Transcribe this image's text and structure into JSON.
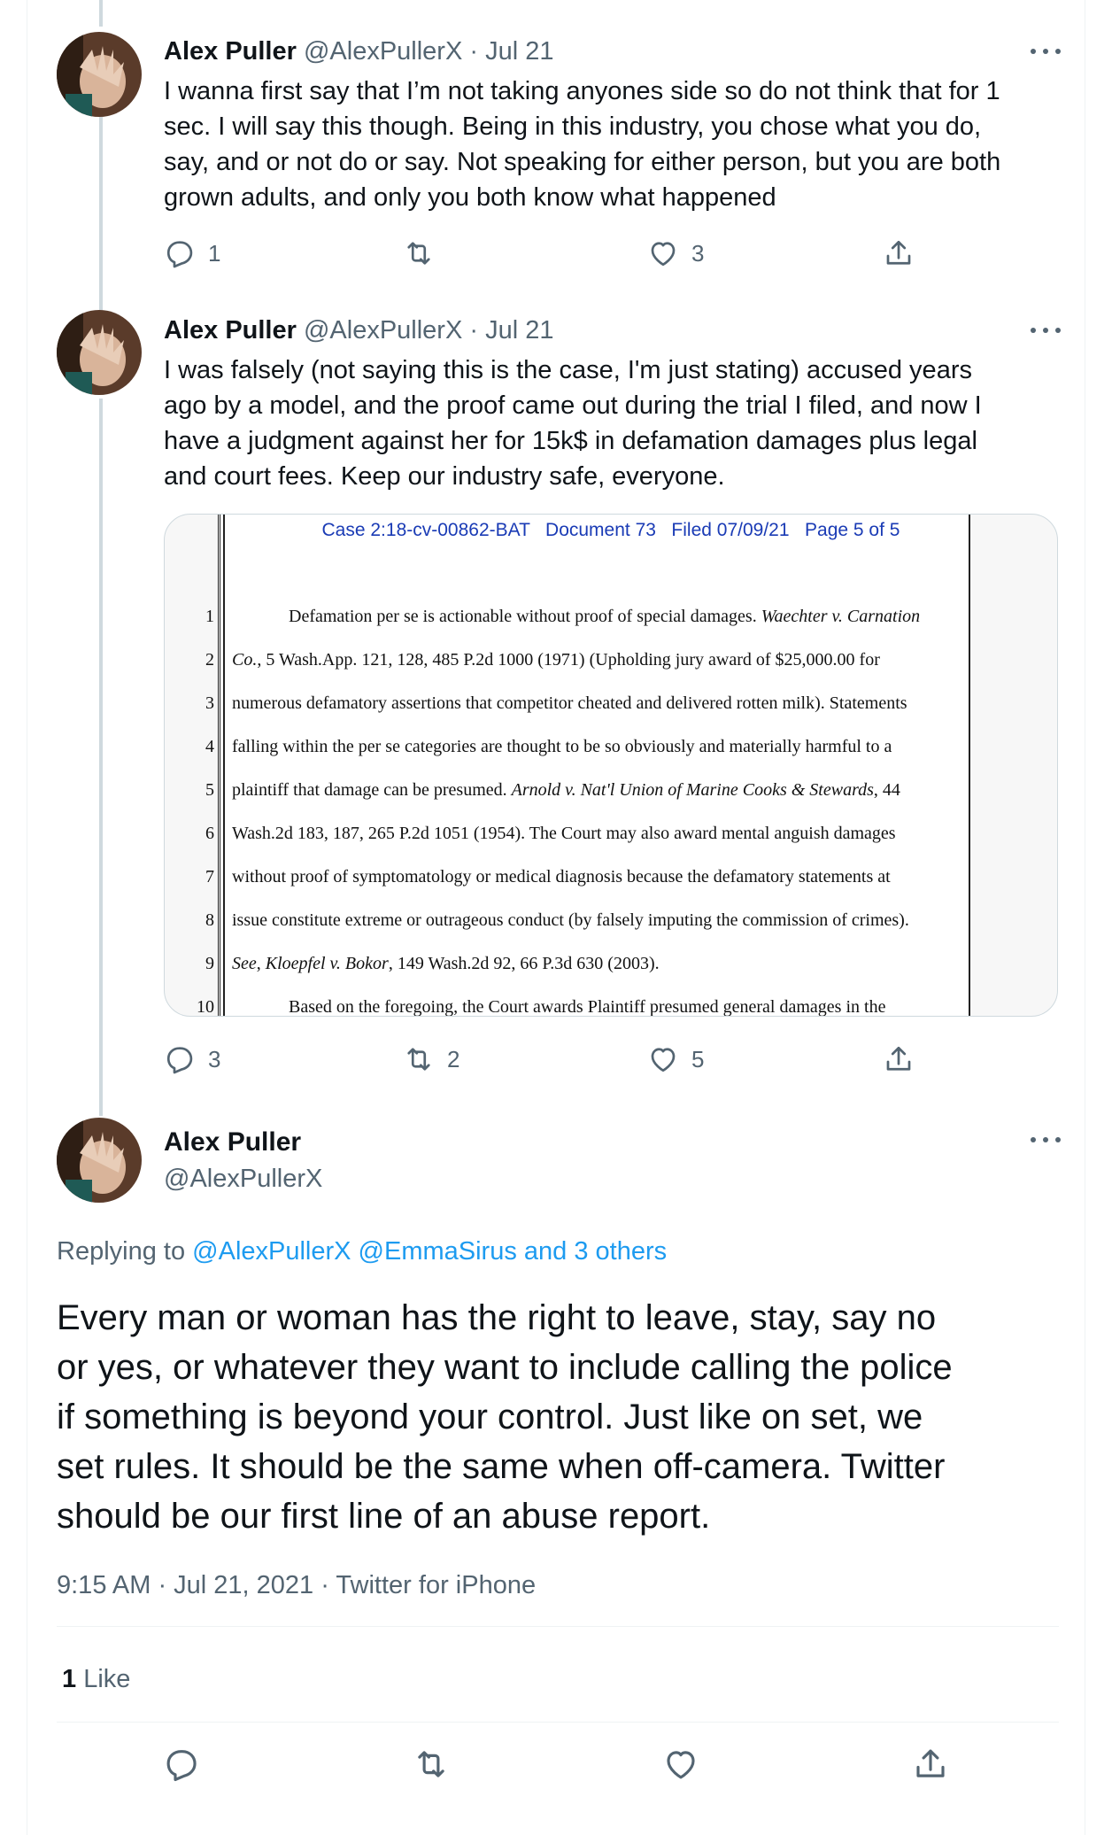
{
  "tweets": [
    {
      "name": "Alex Puller",
      "handle": "@AlexPullerX",
      "dot": "·",
      "date": "Jul 21",
      "lines": [
        "I wanna first say that I’m not taking anyones side so do not think that for 1",
        "sec. I will say this though. Being in this industry, you chose what you do,",
        "say, and or not do or say. Not speaking for either person, but you are both",
        "grown adults, and only you both know what happened"
      ],
      "replies": "1",
      "retweets": "",
      "likes": "3"
    },
    {
      "name": "Alex Puller",
      "handle": "@AlexPullerX",
      "dot": "·",
      "date": "Jul 21",
      "lines": [
        "I was falsely (not saying this is the case, I'm just stating) accused years",
        "ago by a model, and the proof came out during the trial I filed, and now I",
        "have a judgment against her for 15k$ in defamation damages plus legal",
        "and court fees.  Keep our industry safe, everyone."
      ],
      "replies": "3",
      "retweets": "2",
      "likes": "5"
    }
  ],
  "document": {
    "header": "Case 2:18-cv-00862-BAT   Document 73   Filed 07/09/21   Page 5 of 5",
    "lines": [
      {
        "num": "1",
        "html": "Defamation per se is actionable without proof of special damages. <i>Waechter v. Carnation</i>",
        "indent": true
      },
      {
        "num": "2",
        "html": "<i>Co.</i>, 5 Wash.App. 121, 128, 485 P.2d 1000 (1971) (Upholding jury award of $25,000.00 for",
        "indent": false
      },
      {
        "num": "3",
        "html": "numerous defamatory assertions that competitor cheated and delivered rotten milk). Statements",
        "indent": false
      },
      {
        "num": "4",
        "html": "falling within the per se categories are thought to be so obviously and materially harmful to a",
        "indent": false
      },
      {
        "num": "5",
        "html": "plaintiff that damage can be presumed. <i>Arnold v. Nat'l Union of Marine Cooks &amp; Stewards</i>, 44",
        "indent": false
      },
      {
        "num": "6",
        "html": "Wash.2d 183, 187, 265 P.2d 1051 (1954). The Court may also award mental anguish damages",
        "indent": false
      },
      {
        "num": "7",
        "html": "without proof of symptomatology or medical diagnosis because the defamatory statements at",
        "indent": false
      },
      {
        "num": "8",
        "html": "issue constitute extreme or outrageous conduct (by falsely imputing the commission of crimes).",
        "indent": false
      },
      {
        "num": "9",
        "html": "<i>See</i>, <i>Kloepfel v. Bokor</i>, 149 Wash.2d 92, 66 P.3d 630 (2003).",
        "indent": false
      },
      {
        "num": "10",
        "html": "Based on the foregoing, the Court awards Plaintiff presumed general damages in the",
        "indent": true
      }
    ]
  },
  "main_tweet": {
    "name": "Alex Puller",
    "handle": "@AlexPullerX",
    "replying_prefix": "Replying to",
    "replying_to": "@AlexPullerX @EmmaSirus and 3 others",
    "text_lines": [
      "Every man or woman has the right to leave, stay, say no",
      "or yes, or whatever they want to include calling the police",
      "if something is beyond your control. Just like on set, we",
      "set rules. It should be the same when off-camera. Twitter",
      "should be our first line of an abuse report."
    ],
    "meta": "9:15 AM · Jul 21, 2021 · Twitter for iPhone",
    "like_count": "1",
    "like_label": "Like"
  },
  "icons": {
    "reply": "reply-icon",
    "retweet": "retweet-icon",
    "like": "heart-icon",
    "share": "share-icon",
    "more": "more-icon"
  },
  "colors": {
    "accent": "#1d9bf0",
    "secondary_text": "#536471",
    "doc_header": "#1a3bb5"
  }
}
